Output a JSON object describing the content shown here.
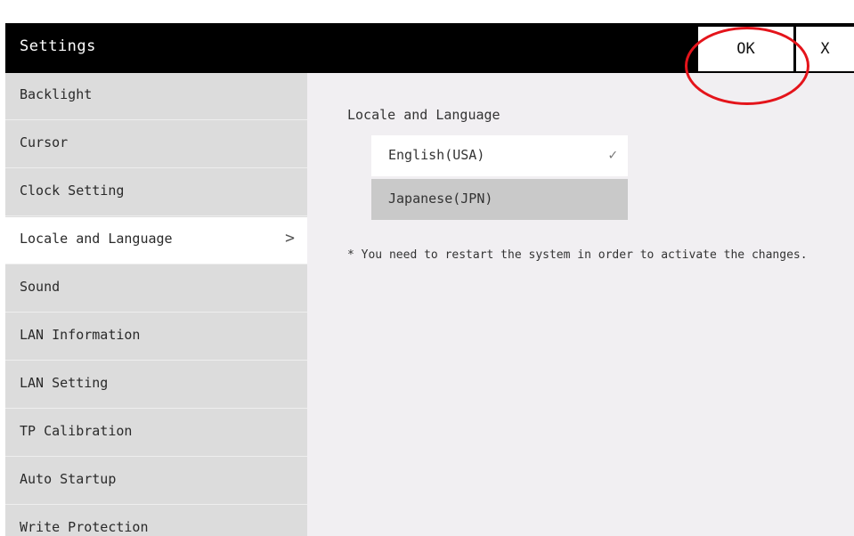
{
  "titlebar": {
    "title": "Settings",
    "ok_label": "OK",
    "close_label": "X"
  },
  "sidebar": {
    "items": [
      {
        "label": "Backlight"
      },
      {
        "label": "Cursor"
      },
      {
        "label": "Clock Setting"
      },
      {
        "label": "Locale and Language",
        "active": true,
        "chevron": ">"
      },
      {
        "label": "Sound"
      },
      {
        "label": "LAN Information"
      },
      {
        "label": "LAN Setting"
      },
      {
        "label": "TP Calibration"
      },
      {
        "label": "Auto Startup"
      },
      {
        "label": "Write Protection"
      }
    ]
  },
  "content": {
    "section_title": "Locale and Language",
    "options": [
      {
        "label": "English(USA)",
        "selected": true,
        "check": "✓"
      },
      {
        "label": "Japanese(JPN)",
        "selected": false
      }
    ],
    "note": "* You need to restart the system in order to activate the changes."
  },
  "colors": {
    "titlebar_bg": "#000000",
    "sidebar_bg": "#dcdcdc",
    "active_item_bg": "#ffffff",
    "content_bg": "#f1eff2",
    "unselected_option_bg": "#c9c9c9",
    "annotation_circle": "#e4141b"
  }
}
